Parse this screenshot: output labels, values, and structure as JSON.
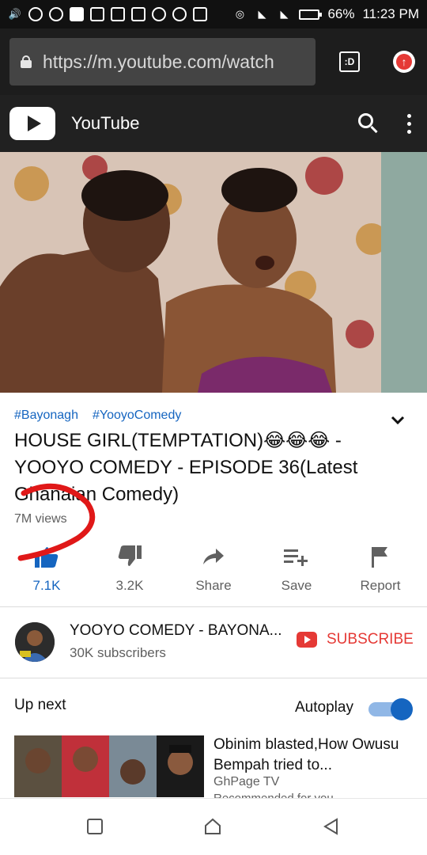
{
  "status_bar": {
    "battery": "66%",
    "time": "11:23 PM",
    "battery_level": 0.66
  },
  "browser": {
    "url": "https://m.youtube.com/watch",
    "tab_count": ":D"
  },
  "youtube": {
    "app_name": "YouTube"
  },
  "video": {
    "hashtags": [
      "#Bayonagh",
      "#YooyoComedy"
    ],
    "title": "HOUSE GIRL(TEMPTATION)😂😂😂 - YOOYO COMEDY - EPISODE 36(Latest Ghanaian Comedy)",
    "views": "7M views"
  },
  "actions": {
    "like": "7.1K",
    "dislike": "3.2K",
    "share": "Share",
    "save": "Save",
    "report": "Report"
  },
  "channel": {
    "name": "YOOYO COMEDY - BAYONA...",
    "subscribers": "30K subscribers",
    "subscribe_label": "SUBSCRIBE"
  },
  "up_next": {
    "heading": "Up next",
    "autoplay_label": "Autoplay",
    "autoplay_on": true,
    "item": {
      "title": "Obinim blasted,How Owusu Bempah tried to...",
      "channel": "GhPage TV",
      "note": "Recommended for you"
    }
  },
  "colors": {
    "accent_blue": "#1565c0",
    "subscribe_red": "#e53935",
    "annotation_red": "#e01818"
  }
}
